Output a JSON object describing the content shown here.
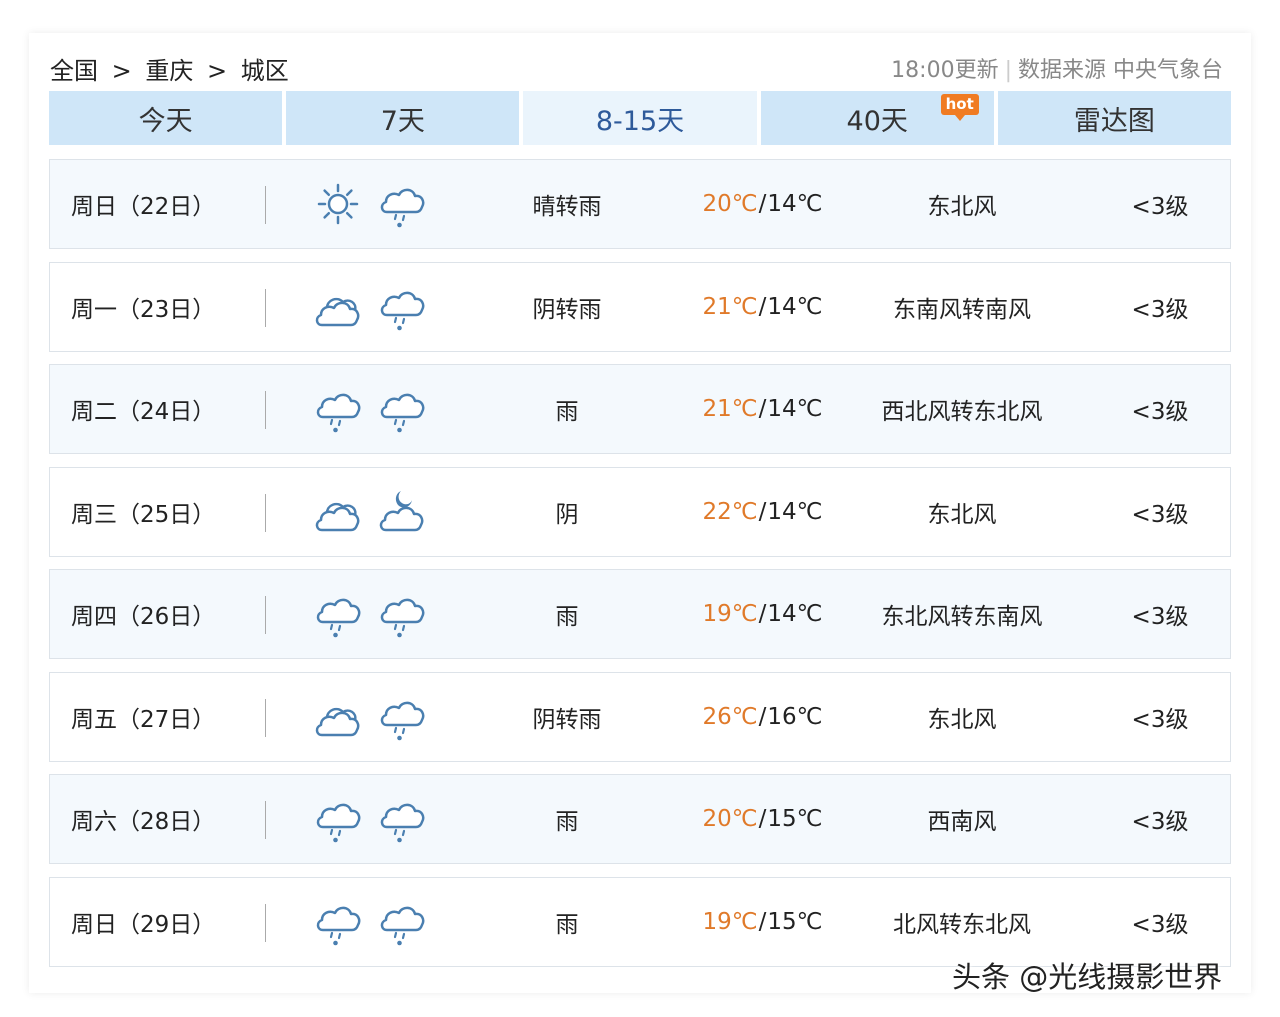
{
  "breadcrumb": [
    "全国",
    "重庆",
    "城区"
  ],
  "breadcrumb_sep": ">",
  "meta": {
    "updated": "18:00更新",
    "source": "数据来源 中央气象台"
  },
  "tabs": [
    {
      "label": "今天"
    },
    {
      "label": "7天"
    },
    {
      "label": "8-15天",
      "active": true
    },
    {
      "label": "40天",
      "badge": "hot"
    },
    {
      "label": "雷达图"
    }
  ],
  "rows": [
    {
      "date": "周日（22日）",
      "icons": [
        "sun-icon",
        "cloud-rain-icon"
      ],
      "desc": "晴转雨",
      "high": "20℃",
      "low": "14℃",
      "wind": "东北风",
      "level": "<3级"
    },
    {
      "date": "周一（23日）",
      "icons": [
        "cloud-icon",
        "cloud-rain-icon"
      ],
      "desc": "阴转雨",
      "high": "21℃",
      "low": "14℃",
      "wind": "东南风转南风",
      "level": "<3级"
    },
    {
      "date": "周二（24日）",
      "icons": [
        "cloud-rain-icon",
        "cloud-rain-icon"
      ],
      "desc": "雨",
      "high": "21℃",
      "low": "14℃",
      "wind": "西北风转东北风",
      "level": "<3级"
    },
    {
      "date": "周三（25日）",
      "icons": [
        "cloud-icon",
        "cloud-moon-icon"
      ],
      "desc": "阴",
      "high": "22℃",
      "low": "14℃",
      "wind": "东北风",
      "level": "<3级"
    },
    {
      "date": "周四（26日）",
      "icons": [
        "cloud-rain-icon",
        "cloud-rain-icon"
      ],
      "desc": "雨",
      "high": "19℃",
      "low": "14℃",
      "wind": "东北风转东南风",
      "level": "<3级"
    },
    {
      "date": "周五（27日）",
      "icons": [
        "cloud-icon",
        "cloud-rain-icon"
      ],
      "desc": "阴转雨",
      "high": "26℃",
      "low": "16℃",
      "wind": "东北风",
      "level": "<3级"
    },
    {
      "date": "周六（28日）",
      "icons": [
        "cloud-rain-icon",
        "cloud-rain-icon"
      ],
      "desc": "雨",
      "high": "20℃",
      "low": "15℃",
      "wind": "西南风",
      "level": "<3级"
    },
    {
      "date": "周日（29日）",
      "icons": [
        "cloud-rain-icon",
        "cloud-rain-icon"
      ],
      "desc": "雨",
      "high": "19℃",
      "low": "15℃",
      "wind": "北风转东北风",
      "level": "<3级"
    }
  ],
  "colors": {
    "high_temp": "#e07a2a",
    "tab_bg": "#cfe6f8",
    "tab_active_bg": "#eaf4fc",
    "tab_active_text": "#2e5a9a",
    "icon": "#4a7fb0",
    "hot_badge": "#f07b22"
  },
  "watermark": "头条 @光线摄影世界"
}
